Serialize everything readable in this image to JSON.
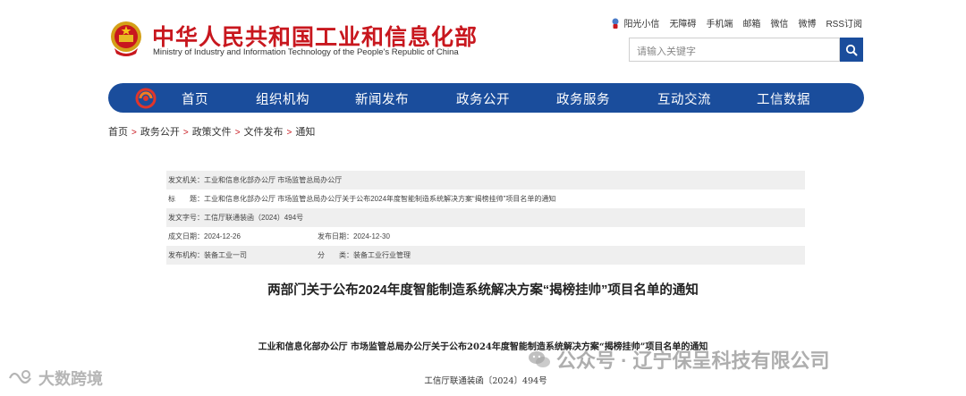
{
  "header": {
    "title_cn": "中华人民共和国工业和信息化部",
    "title_en": "Ministry of Industry and Information Technology of the People's Republic of China",
    "top_links": [
      "阳光小信",
      "无障碍",
      "手机端",
      "邮箱",
      "微信",
      "微博",
      "RSS订阅"
    ],
    "search_placeholder": "请输入关键字"
  },
  "nav": {
    "items": [
      "首页",
      "组织机构",
      "新闻发布",
      "政务公开",
      "政务服务",
      "互动交流",
      "工信数据"
    ]
  },
  "breadcrumb": [
    "首页",
    "政务公开",
    "政策文件",
    "文件发布",
    "通知"
  ],
  "meta": {
    "issuer": "发文机关：工业和信息化部办公厅 市场监管总局办公厅",
    "title": "标　　题：工业和信息化部办公厅 市场监管总局办公厅关于公布2024年度智能制造系统解决方案“揭榜挂帅”项目名单的通知",
    "doc_no": "发文字号：工信厅联通装函（2024）494号",
    "created_date": "成文日期：2024-12-26",
    "published_date": "发布日期：2024-12-30",
    "org": "发布机构：装备工业一司",
    "category": "分　　类：装备工业行业管理"
  },
  "article": {
    "title": "两部门关于公布2024年度智能制造系统解决方案“揭榜挂帅”项目名单的通知",
    "subtitle": "工业和信息化部办公厅  市场监管总局办公厅关于公布2024年度智能制造系统解决方案“揭榜挂帅”项目名单的通知",
    "doc_no": "工信厅联通装函〔2024〕494号"
  },
  "watermarks": {
    "left": "大数跨境",
    "right": "公众号 · 辽宁保呈科技有限公司"
  },
  "colors": {
    "brand_red": "#c8171e",
    "nav_blue": "#1a4d9c"
  }
}
